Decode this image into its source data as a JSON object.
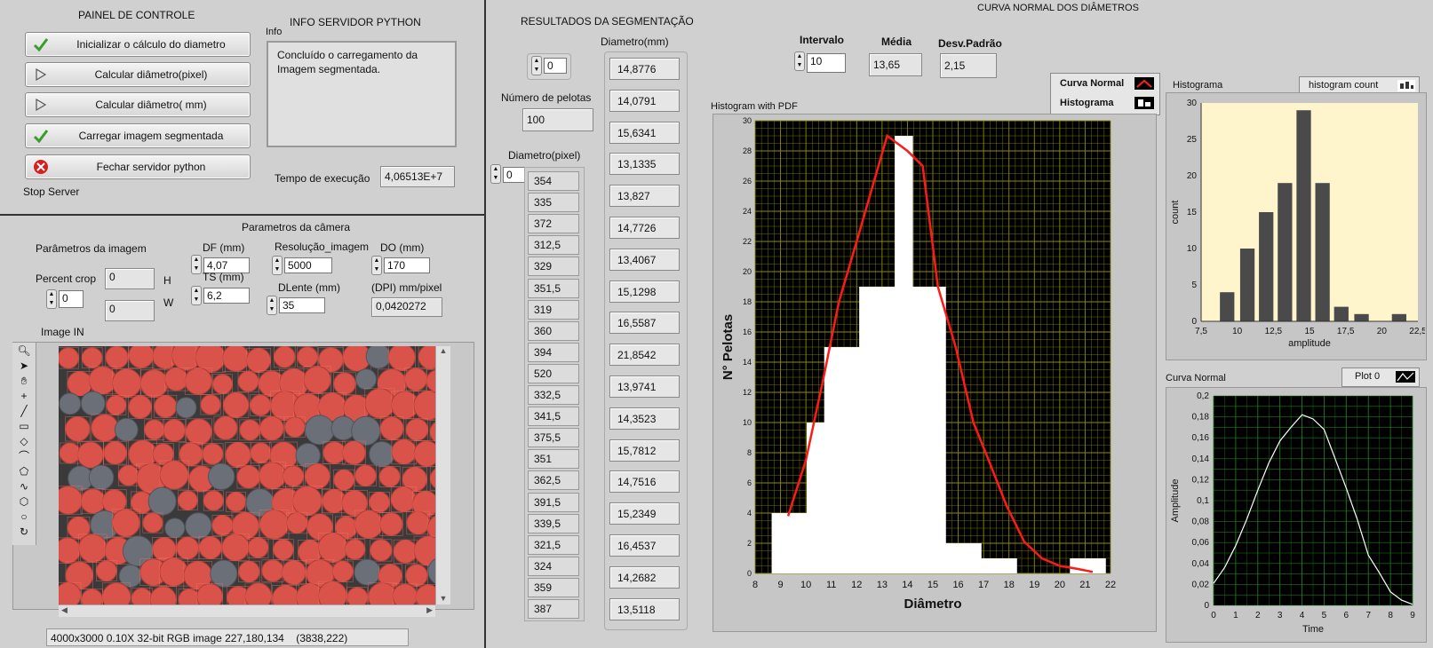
{
  "control_panel": {
    "title": "PAINEL DE CONTROLE",
    "buttons": [
      {
        "label": "Inicializar o cálculo do diametro",
        "icon": "check"
      },
      {
        "label": "Calcular diâmetro(pixel)",
        "icon": "play"
      },
      {
        "label": "Calcular diâmetro( mm)",
        "icon": "play"
      },
      {
        "label": "Carregar imagem segmentada",
        "icon": "check"
      },
      {
        "label": "Fechar servidor python",
        "icon": "close"
      }
    ],
    "stop_label": "Stop Server"
  },
  "info": {
    "title": "INFO SERVIDOR PYTHON",
    "label": "Info",
    "text": "Concluído o carregamento da Imagem segmentada.",
    "exec_label": "Tempo de execução",
    "exec_value": "4,06513E+7"
  },
  "camera": {
    "title": "Parametros da câmera",
    "image_params_label": "Parâmetros da imagem",
    "percent_crop_label": "Percent crop",
    "percent_crop_value": "0",
    "h_label": "H",
    "h_value": "0",
    "w_label": "W",
    "w_value": "0",
    "df_label": "DF (mm)",
    "df_value": "4,07",
    "ts_label": "TS (mm)",
    "ts_value": "6,2",
    "res_label": "Resolução_imagem",
    "res_value": "5000",
    "do_label": "DO (mm)",
    "do_value": "170",
    "dlente_label": "DLente (mm)",
    "dlente_value": "35",
    "dpi_label": "(DPI) mm/pixel",
    "dpi_value": "0,0420272"
  },
  "image": {
    "title": "Image IN",
    "status": "4000x3000 0.10X 32-bit RGB image 227,180,134    (3838,222)"
  },
  "results": {
    "title": "RESULTADOS DA SEGMENTAÇÃO",
    "index_value": "0",
    "num_label": "Número de pelotas",
    "num_value": "100",
    "pixel_label": "Diametro(pixel)",
    "pixel_index": "0",
    "pixel_values": [
      "354",
      "335",
      "372",
      "312,5",
      "329",
      "351,5",
      "319",
      "360",
      "394",
      "520",
      "332,5",
      "341,5",
      "375,5",
      "351",
      "362,5",
      "391,5",
      "339,5",
      "321,5",
      "324",
      "359",
      "387"
    ],
    "mm_label": "Diametro(mm)",
    "mm_values": [
      "14,8776",
      "14,0791",
      "15,6341",
      "13,1335",
      "13,827",
      "14,7726",
      "13,4067",
      "15,1298",
      "16,5587",
      "21,8542",
      "13,9741",
      "14,3523",
      "15,7812",
      "14,7516",
      "15,2349",
      "16,4537",
      "14,2682",
      "13,5118"
    ]
  },
  "normal_curve": {
    "title": "CURVA NORMAL DOS DIÂMETROS",
    "intervalo_label": "Intervalo",
    "intervalo_value": "10",
    "media_label": "Média",
    "media_value": "13,65",
    "desv_label": "Desv.Padrão",
    "desv_value": "2,15",
    "legend_curve": "Curva Normal",
    "legend_hist": "Histograma"
  },
  "colors": {
    "panel_bg": "#d0d0d0",
    "plot_bg": "#000000",
    "grid": "#8c8c00",
    "curve": "#ff1a1a",
    "hist": "#ffffff",
    "small_hist_bg": "#fff5cc",
    "small_bar": "#4a4a4a",
    "green_plot_bg": "#000000",
    "green_grid": "#1f7a1f"
  },
  "chart_data": [
    {
      "type": "bar",
      "title": "Histogram with PDF",
      "xlabel": "Diâmetro",
      "ylabel": "N°  Pelotas",
      "xlim": [
        8,
        22
      ],
      "ylim": [
        0,
        30
      ],
      "x_ticks": [
        "8",
        "9",
        "10",
        "11",
        "12",
        "13",
        "14",
        "15",
        "16",
        "17",
        "18",
        "19",
        "20",
        "21",
        "22"
      ],
      "y_ticks": [
        "0",
        "2",
        "4",
        "6",
        "8",
        "10",
        "12",
        "14",
        "16",
        "18",
        "20",
        "22",
        "24",
        "26",
        "28",
        "30"
      ],
      "bin_edges": [
        8.65,
        9.34,
        10.03,
        10.72,
        11.4,
        12.1,
        12.8,
        13.5,
        14.2,
        14.9,
        15.5,
        16.2,
        16.9,
        17.6,
        18.3,
        19.0,
        19.7,
        20.4,
        21.1,
        21.8
      ],
      "values": [
        4,
        4,
        10,
        15,
        15,
        19,
        19,
        29,
        19,
        19,
        2,
        2,
        1,
        1,
        0,
        0,
        0,
        1,
        1
      ],
      "series": [
        {
          "name": "Curva Normal",
          "x": [
            9.3,
            10.0,
            10.7,
            11.3,
            12.0,
            12.6,
            13.2,
            14.0,
            14.6,
            15.2,
            15.9,
            16.6,
            17.2,
            17.9,
            18.6,
            19.3,
            20.0,
            20.7,
            21.3
          ],
          "values": [
            3.8,
            7.5,
            13.0,
            18.0,
            22.0,
            25.5,
            29.0,
            28.0,
            27.0,
            19.0,
            15.0,
            10.0,
            7.5,
            4.5,
            2.1,
            1.0,
            0.5,
            0.3,
            0.1
          ]
        },
        {
          "name": "Histograma"
        }
      ]
    },
    {
      "type": "bar",
      "title": "Histograma",
      "legend": "histogram count",
      "xlabel": "amplitude",
      "ylabel": "count",
      "xlim": [
        7.5,
        22.5
      ],
      "ylim": [
        0,
        30
      ],
      "x_ticks": [
        "7,5",
        "10",
        "12,5",
        "15",
        "17,5",
        "20",
        "22,5"
      ],
      "y_ticks": [
        "0",
        "5",
        "10",
        "15",
        "20",
        "25",
        "30"
      ],
      "x": [
        9.3,
        10.7,
        12.0,
        13.3,
        14.6,
        15.9,
        17.2,
        18.6,
        19.9,
        21.2
      ],
      "values": [
        4,
        10,
        15,
        19,
        29,
        19,
        2,
        1,
        0,
        1
      ]
    },
    {
      "type": "line",
      "title": "Curva Normal",
      "legend": "Plot 0",
      "xlabel": "Time",
      "ylabel": "Amplitude",
      "xlim": [
        0,
        9
      ],
      "ylim": [
        0,
        0.2
      ],
      "x_ticks": [
        "0",
        "1",
        "2",
        "3",
        "4",
        "5",
        "6",
        "7",
        "8",
        "9"
      ],
      "y_ticks": [
        "0",
        "0,02",
        "0,04",
        "0,06",
        "0,08",
        "0,1",
        "0,12",
        "0,14",
        "0,16",
        "0,18",
        "0,2"
      ],
      "x": [
        0,
        0.5,
        1,
        1.5,
        2,
        2.5,
        3,
        3.5,
        4,
        4.5,
        5,
        5.5,
        6,
        6.5,
        7,
        7.5,
        8,
        8.5,
        9
      ],
      "values": [
        0.021,
        0.036,
        0.057,
        0.082,
        0.11,
        0.136,
        0.157,
        0.17,
        0.182,
        0.178,
        0.168,
        0.14,
        0.112,
        0.082,
        0.048,
        0.031,
        0.013,
        0.005,
        0.001
      ]
    }
  ]
}
